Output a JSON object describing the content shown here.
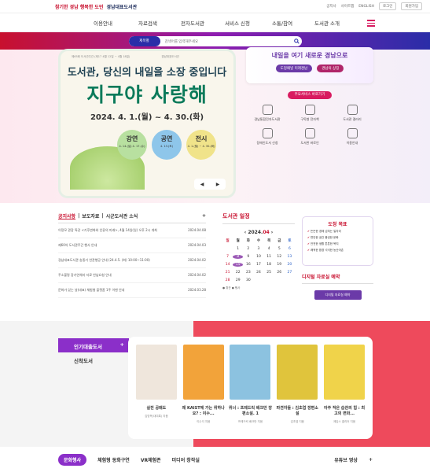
{
  "top": {
    "slogan": "참기한 경남 행복한 도민",
    "lib_name": "경남대표도서관",
    "util": [
      "로그인",
      "회원가입"
    ],
    "links": [
      "공지사",
      "사이트맵",
      "ENGLISH"
    ]
  },
  "gnb": [
    "이용안내",
    "자료검색",
    "전자도서관",
    "서비스 신청",
    "소통/참여",
    "도서관 소개"
  ],
  "search": {
    "select": "제목별",
    "placeholder": "검색어를 입력해주세요"
  },
  "banner": {
    "top_left": "제65회 도서관주간 (제17 4월 12일 ~ 4월 18일)",
    "top_right": "경남대표도서관",
    "title1": "도서관, 당신의 내일을 소장 중입니다",
    "title2": "지구야 사랑해",
    "date": "2024. 4. 1.(월) ~ 4. 30.(화)",
    "events": [
      {
        "name": "강연",
        "dates": "4. 14.(일) 4. 17.(수)"
      },
      {
        "name": "공연",
        "dates": "4. 13.(토)"
      },
      {
        "name": "전시",
        "dates": "4. 1.(월) ~ 4. 30.(화)"
      }
    ]
  },
  "side": {
    "slogan": "내일을 여기 새로운 경남으로",
    "btn1": "도정패널 미래경남",
    "btn2": "경남의 상징",
    "svc_head": "주요서비스 바로가기",
    "svc": [
      "경남통합전자도서관",
      "구독형 전자책",
      "도서관 갤러리",
      "장애인도서 신청",
      "도서관 바로인",
      "이용안내"
    ]
  },
  "notice": {
    "tabs": [
      "공지사항",
      "보도자료",
      "시군도서관 소식"
    ],
    "items": [
      {
        "t": "이정모 관장 특강 <기후변화와 인류의 미래>, 4월 14일(일) 오후 2시 개최",
        "d": "2024.04.08"
      },
      {
        "t": "제60차 도서관주간 행사 안내",
        "d": "2024.04.03"
      },
      {
        "t": "경남대표도서관 송중기 연관행공 안내 (24.4.5. (화) 10:00~11:00)",
        "d": "2024.04.02"
      },
      {
        "t": "주소불명 장기연체자 자료 반납요청 안내",
        "d": "2024.04.02"
      },
      {
        "t": "문화가 있는 날(대표) 체험형 플랫폼 1주 이벤 안내",
        "d": "2024.03.28"
      }
    ]
  },
  "cal": {
    "title": "도서관 일정",
    "year": "2024.",
    "month": "04",
    "days": [
      "일",
      "월",
      "화",
      "수",
      "목",
      "금",
      "토"
    ],
    "cells": [
      "",
      "1",
      "2",
      "3",
      "4",
      "5",
      "6",
      "7",
      "8",
      "9",
      "10",
      "11",
      "12",
      "13",
      "14",
      "15",
      "16",
      "17",
      "18",
      "19",
      "20",
      "21",
      "22",
      "23",
      "24",
      "25",
      "26",
      "27",
      "28",
      "29",
      "30"
    ],
    "legend": "● 휴관  ● 행사"
  },
  "goal": {
    "title": "도정 목표",
    "items": [
      "든든한 경제 넘치는 일자리",
      "편안한 공간 풍성한 문화",
      "안전한 생활 튼튼한 복지",
      "쾌적한 환경 넉넉한 농산어촌"
    ]
  },
  "dig": {
    "title": "디지털 자료실 예약",
    "btn": "디지털 자료실 예약"
  },
  "books": {
    "cats": [
      "인기대출도서",
      "신착도서"
    ],
    "list": [
      {
        "t": "실전 공매도",
        "a": "김영옥(대여록) 지음",
        "c": "#efe6dc"
      },
      {
        "t": "왜 KAIST에 가는 위하나요? : 이수...",
        "a": "이수석 지음",
        "c": "#f2a33a"
      },
      {
        "t": "위너 : 프레드릭 배크만 장편소설. 1",
        "a": "프레드릭 배크만 지음",
        "c": "#8cc2e0"
      },
      {
        "t": "파견자들 : 김초엽 장편소설",
        "a": "김초엽 지음",
        "c": "#e0c43c"
      },
      {
        "t": "아주 작은 습관의 힘 : 최고의 변화...",
        "a": "제임스 클리어 지음",
        "c": "#f0d34a"
      }
    ]
  },
  "foot": {
    "tabs": [
      "문화행사",
      "체험형 동화구연",
      "VR체험존",
      "미디어 창작실"
    ],
    "yt": "유튜브 영상"
  }
}
